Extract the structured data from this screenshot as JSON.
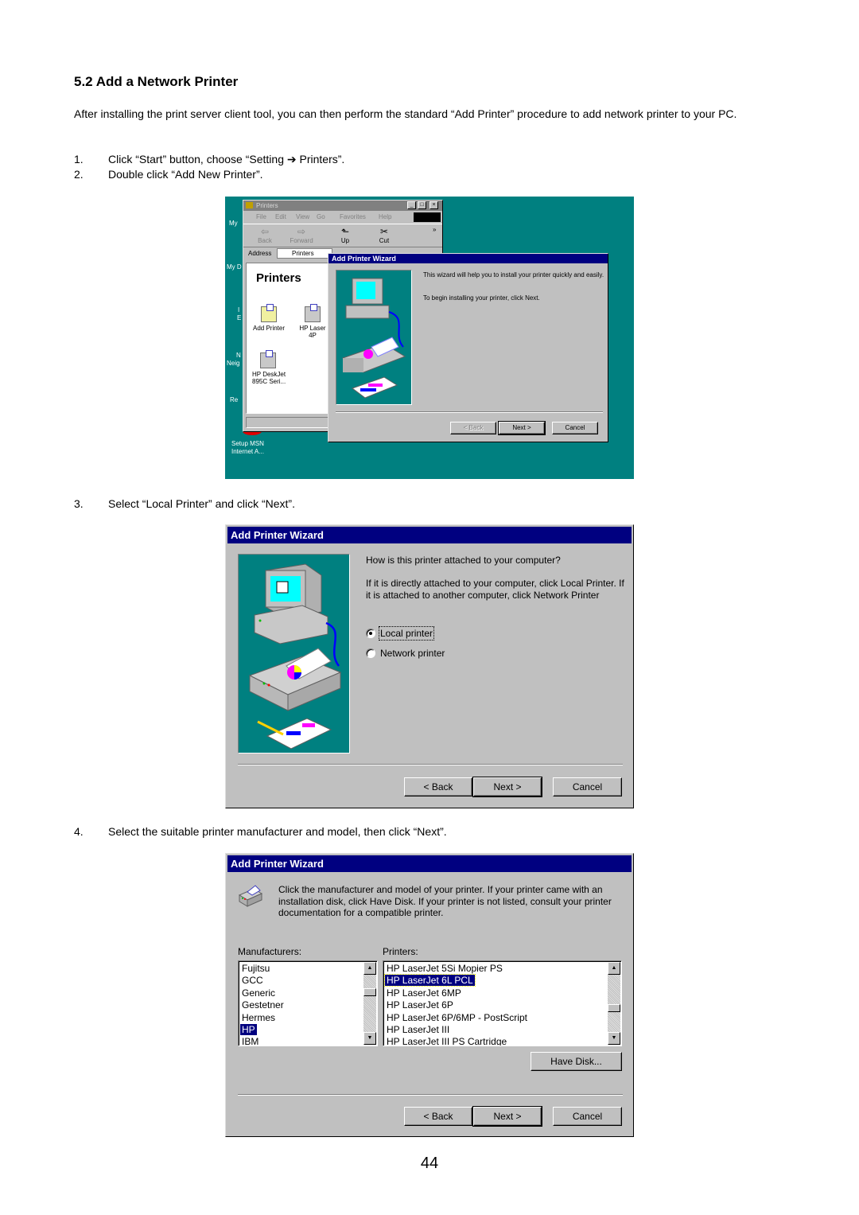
{
  "document": {
    "section_title": "5.2 Add a Network Printer",
    "intro": "After installing the print server client tool, you can then perform the standard “Add Printer” procedure to add network printer to your PC.",
    "steps": [
      {
        "num": "1.",
        "text": "Click “Start” button, choose “Setting ➔ Printers”."
      },
      {
        "num": "2.",
        "text": "Double click “Add New Printer”."
      },
      {
        "num": "3.",
        "text": "Select “Local Printer” and click “Next”."
      },
      {
        "num": "4.",
        "text": "Select the suitable printer manufacturer and model, then click “Next”."
      }
    ],
    "page_number": "44"
  },
  "shot1": {
    "desktop_labels": [
      "My",
      "My D",
      "I",
      "E",
      "N",
      "Neig",
      "Re"
    ],
    "desktop_setup": "Setup MSN\nInternet A...",
    "printers_window": {
      "title": "Printers",
      "menu": [
        "File",
        "Edit",
        "View",
        "Go",
        "Favorites",
        "Help"
      ],
      "toolbar": [
        {
          "icon": "back-arrow-icon",
          "glyph": "⇦",
          "label": "Back"
        },
        {
          "icon": "forward-arrow-icon",
          "glyph": "⇨",
          "label": "Forward"
        },
        {
          "icon": "up-folder-icon",
          "glyph": "⬑",
          "label": "Up"
        },
        {
          "icon": "scissors-icon",
          "glyph": "✂",
          "label": "Cut"
        }
      ],
      "more": "»",
      "address_label": "Address",
      "address_value": "Printers",
      "pane_heading": "Printers",
      "items": [
        {
          "label": "Add Printer"
        },
        {
          "label": "HP Laser\n4P"
        },
        {
          "label": "HP DeskJet\n895C Seri..."
        }
      ]
    },
    "wizard": {
      "title": "Add Printer Wizard",
      "text1": "This wizard will help you to install your printer quickly and easily.",
      "text2": "To begin installing your printer, click Next.",
      "back": "< Back",
      "next": "Next >",
      "cancel": "Cancel"
    }
  },
  "shot2": {
    "title": "Add Printer Wizard",
    "question": "How is this printer attached to your computer?",
    "explanation": "If it is directly attached to your computer, click Local Printer. If it is attached to another computer, click Network Printer",
    "options": [
      {
        "label": "Local printer",
        "selected": true
      },
      {
        "label": "Network printer",
        "selected": false
      }
    ],
    "back": "< Back",
    "next": "Next >",
    "cancel": "Cancel"
  },
  "shot3": {
    "title": "Add Printer Wizard",
    "instructions": "Click the manufacturer and model of your printer. If your printer came with an installation disk, click Have Disk. If your printer is not listed, consult your printer documentation for a compatible printer.",
    "manufacturers_label": "Manufacturers:",
    "printers_label": "Printers:",
    "manufacturers": [
      "Fujitsu",
      "GCC",
      "Generic",
      "Gestetner",
      "Hermes",
      "HP",
      "IBM"
    ],
    "selected_manufacturer": "HP",
    "printers": [
      "HP LaserJet 5Si Mopier PS",
      "HP LaserJet 6L PCL",
      "HP LaserJet 6MP",
      "HP LaserJet 6P",
      "HP LaserJet 6P/6MP - PostScript",
      "HP LaserJet III",
      "HP LaserJet III PS Cartridge"
    ],
    "selected_printer": "HP LaserJet 6L PCL",
    "have_disk": "Have Disk...",
    "back": "< Back",
    "next": "Next >",
    "cancel": "Cancel"
  },
  "colors": {
    "titlebar": "#000080",
    "dialog_face": "#c0c0c0",
    "desktop": "#008080"
  }
}
